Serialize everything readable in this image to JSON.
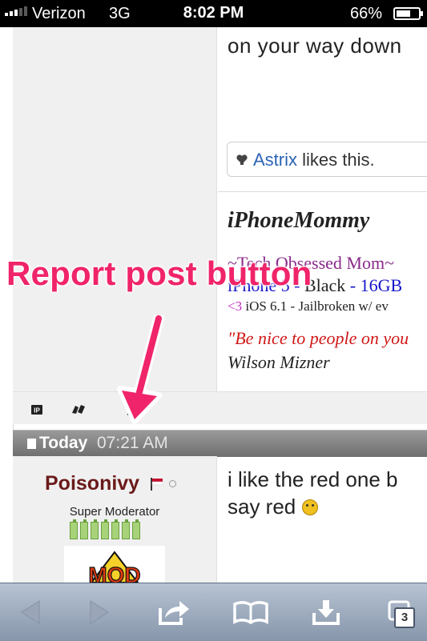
{
  "status_bar": {
    "carrier": "Verizon",
    "network": "3G",
    "time": "8:02 PM",
    "battery": "66%",
    "battery_fraction": 0.66
  },
  "post_previous": {
    "body_text": "on your way down",
    "likes": {
      "name": "Astrix",
      "suffix": " likes this."
    },
    "signature": {
      "title": "iPhoneMommy",
      "tagline": "~Tech Obsessed Mom~",
      "device_model": "iPhone 5",
      "device_sep1": " - ",
      "device_color": "Black",
      "device_sep2": " - ",
      "device_storage": "16GB",
      "ios_heart": "<3",
      "ios_text": " iOS 6.1 - Jailbroken w/ ev",
      "quote": "\"Be nice to people on you",
      "quote_author": "Wilson Mizner"
    }
  },
  "post_toolbar": {
    "ip_label": "IP"
  },
  "post_header": {
    "day": "Today",
    "time": "07:21 AM"
  },
  "post_current": {
    "username": "Poisonivy",
    "user_title": "Super Moderator",
    "reputation_level": 7,
    "logo_text": "MOD",
    "body_line1": "i like the red one b",
    "body_line2": "say red"
  },
  "annotation": {
    "label": "Report post button"
  },
  "safari_toolbar": {
    "tab_count": "3"
  },
  "colors": {
    "annotation": "#f0246a",
    "username": "#6b1a1a",
    "link_blue": "#2a64b5",
    "quote_red": "#d01818",
    "safari_bar": "#9aa7b9"
  }
}
